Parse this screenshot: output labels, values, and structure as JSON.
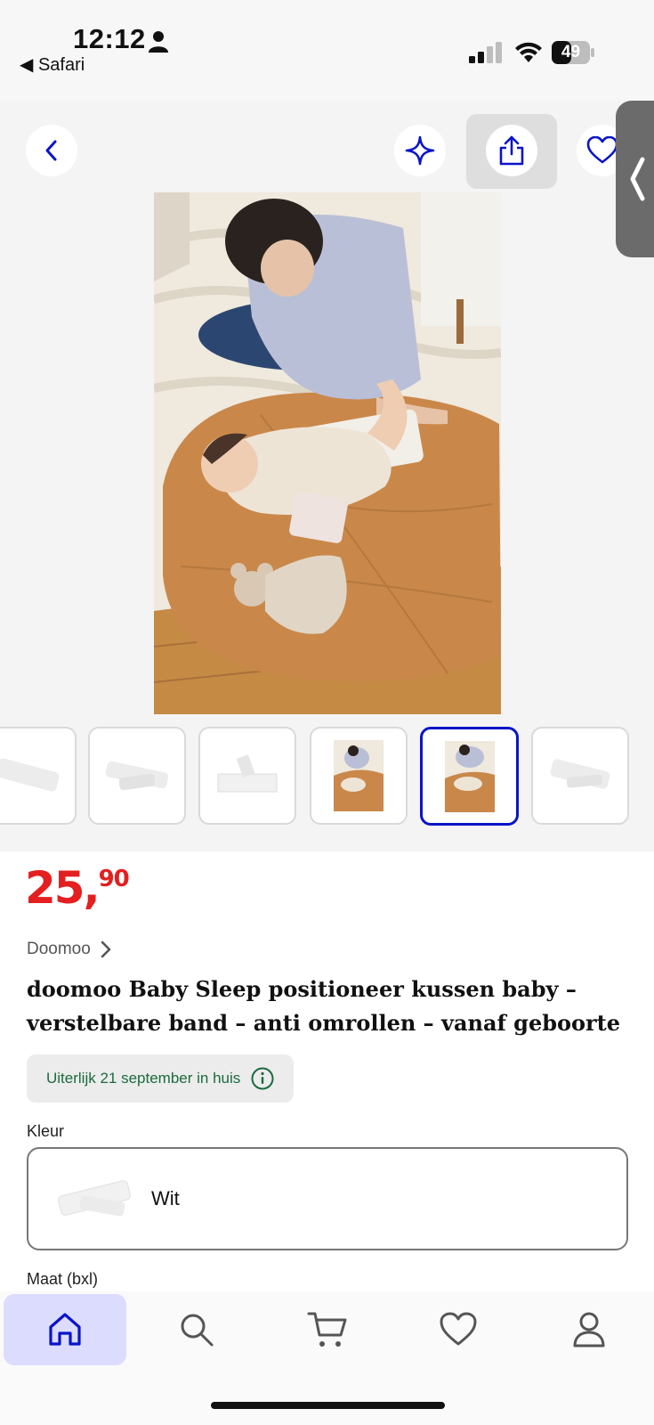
{
  "status_bar": {
    "time": "12:12",
    "back_app": "Safari",
    "battery": "49"
  },
  "gallery": {
    "thumbnail_count": 6,
    "active_thumbnail_index": 4
  },
  "product": {
    "price_main": "25,",
    "price_cents": "90",
    "brand": "Doomoo",
    "title": "doomoo Baby Sleep positioneer kussen baby – verstelbare band – anti omrollen – vanaf geboorte",
    "delivery": "Uiterlijk 21 september in huis",
    "color_label": "Kleur",
    "color_value": "Wit",
    "size_label": "Maat (bxl)"
  },
  "colors": {
    "accent": "#0a14c8",
    "price": "#e41f1f",
    "delivery_text": "#1b6b3d"
  },
  "nav": {
    "items": [
      "home-icon",
      "search-icon",
      "cart-icon",
      "heart-icon",
      "user-icon"
    ],
    "active": "home-icon"
  }
}
